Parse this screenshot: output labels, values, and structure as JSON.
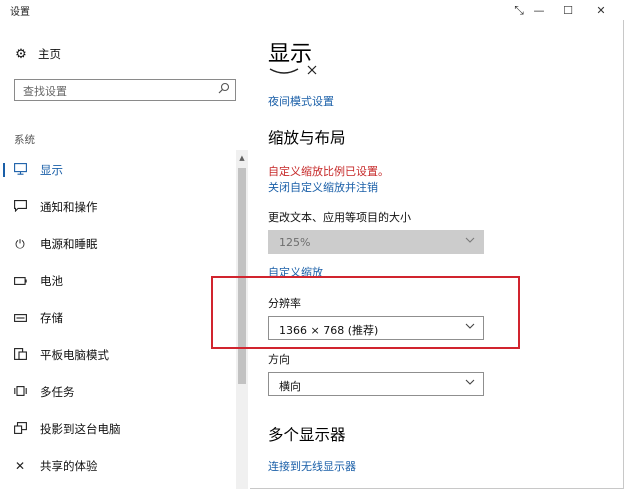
{
  "window": {
    "title": "设置",
    "buttons": {
      "snap": "⤡",
      "minimize": "—",
      "maximize": "☐",
      "close": "✕"
    }
  },
  "sidebar": {
    "home": {
      "label": "主页",
      "icon": "gear-icon"
    },
    "search": {
      "placeholder": "查找设置",
      "icon": "search-icon"
    },
    "section": "系统",
    "items": [
      {
        "label": "显示",
        "icon": "monitor-icon",
        "active": true
      },
      {
        "label": "通知和操作",
        "icon": "notification-icon"
      },
      {
        "label": "电源和睡眠",
        "icon": "power-icon"
      },
      {
        "label": "电池",
        "icon": "battery-icon"
      },
      {
        "label": "存储",
        "icon": "storage-icon"
      },
      {
        "label": "平板电脑模式",
        "icon": "tablet-mode-icon"
      },
      {
        "label": "多任务",
        "icon": "multitask-icon"
      },
      {
        "label": "投影到这台电脑",
        "icon": "project-icon"
      },
      {
        "label": "共享的体验",
        "icon": "share-icon"
      }
    ]
  },
  "main": {
    "title": "显示",
    "night_mode_link": "夜间模式设置",
    "scale_section": {
      "heading": "缩放与布局",
      "warning": "自定义缩放比例已设置。",
      "disable_link": "关闭自定义缩放并注销",
      "text_size_label": "更改文本、应用等项目的大小",
      "scale_value": "125%",
      "custom_scale_link": "自定义缩放"
    },
    "resolution": {
      "label": "分辨率",
      "value": "1366 × 768 (推荐)"
    },
    "orientation": {
      "label": "方向",
      "value": "横向"
    },
    "multi_display": {
      "heading": "多个显示器",
      "wireless_link": "连接到无线显示器"
    }
  },
  "colors": {
    "accent": "#1a5fa8",
    "warning": "#c62828",
    "highlight_box": "#d1242e"
  }
}
